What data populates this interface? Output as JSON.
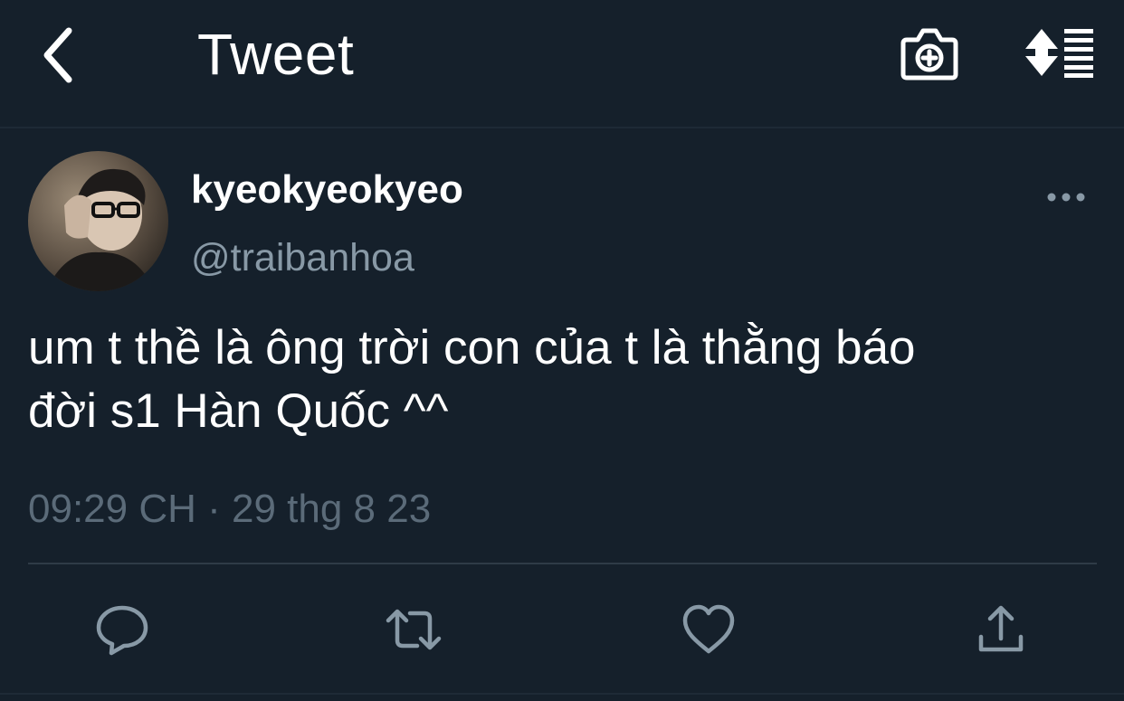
{
  "header": {
    "title": "Tweet",
    "back_icon": "chevron-left-icon",
    "camera_icon": "camera-plus-icon",
    "sort_icon": "sort-list-icon"
  },
  "tweet": {
    "display_name": "kyeokyeokyeo",
    "handle": "@traibanhoa",
    "text": "um t thề là ông trời con của t là thằng báo\nđời s1 Hàn Quốc ^^",
    "timestamp": "09:29 CH · 29 thg 8 23"
  },
  "actions": {
    "reply_icon": "reply-icon",
    "retweet_icon": "retweet-icon",
    "like_icon": "heart-icon",
    "share_icon": "share-icon"
  },
  "colors": {
    "background": "#15202b",
    "text": "#ffffff",
    "secondary": "#8899a6",
    "divider": "#2f3b47"
  }
}
